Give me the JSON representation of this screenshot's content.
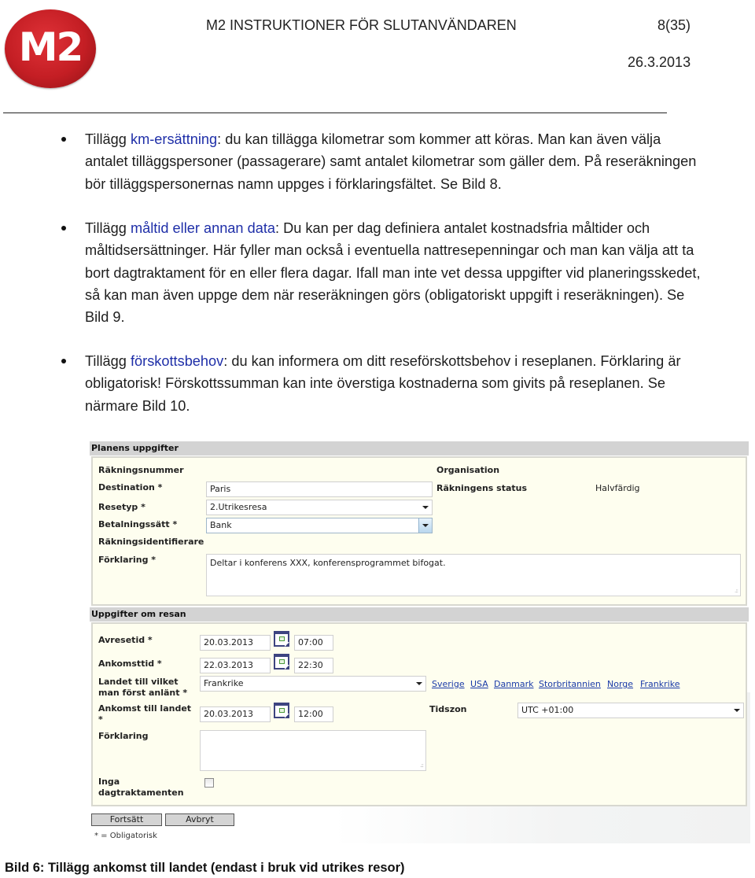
{
  "header": {
    "logo_text": "M2",
    "title": "M2 INSTRUKTIONER FÖR SLUTANVÄNDAREN",
    "page": "8(35)",
    "date": "26.3.2013"
  },
  "bullets": [
    {
      "prefix": "Tillägg ",
      "keyword": "km-ersättning",
      "text": ": du kan tillägga kilometrar som kommer att köras. Man kan även välja antalet tilläggspersoner (passagerare) samt antalet kilometrar som gäller dem. På reseräkningen bör tilläggspersonernas namn uppges i förklaringsfältet. Se Bild 8."
    },
    {
      "prefix": "Tillägg ",
      "keyword": "måltid eller annan data",
      "text": ": Du kan per dag definiera antalet kostnadsfria måltider och måltidsersättninger. Här fyller man också i eventuella nattresepenningar och man kan välja att ta bort dagtraktament för en eller flera dagar. Ifall man inte vet dessa uppgifter vid planeringsskedet, så kan man även uppge dem när reseräkningen görs (obligatoriskt uppgift i reseräkningen). Se Bild 9."
    },
    {
      "prefix": "Tillägg ",
      "keyword": "förskottsbehov",
      "text": ": du kan informera om ditt reseförskottsbehov i reseplanen. Förklaring är obligatorisk! Förskottssumman kan inte överstiga kostnaderna som givits på reseplanen. Se närmare Bild 10."
    }
  ],
  "form": {
    "plan_section": {
      "title": "Planens uppgifter",
      "invoice_number_label": "Räkningsnummer",
      "organisation_label": "Organisation",
      "destination_label": "Destination *",
      "destination_value": "Paris",
      "status_label": "Räkningens status",
      "status_value": "Halvfärdig",
      "travel_type_label": "Resetyp *",
      "travel_type_value": "2.Utrikesresa",
      "payment_label": "Betalningssätt *",
      "payment_value": "Bank",
      "identifier_label": "Räkningsidentifierare",
      "explanation_label": "Förklaring *",
      "explanation_value": "Deltar i konferens XXX, konferensprogrammet bifogat."
    },
    "trip_section": {
      "title": "Uppgifter om resan",
      "departure_label": "Avresetid *",
      "departure_date": "20.03.2013",
      "departure_time": "07:00",
      "arrival_label": "Ankomsttid *",
      "arrival_date": "22.03.2013",
      "arrival_time": "22:30",
      "first_country_label_1": "Landet till vilket",
      "first_country_label_2": "man först anlänt *",
      "first_country_value": "Frankrike",
      "country_links": [
        "Sverige",
        "USA",
        "Danmark",
        "Storbritannien",
        "Norge",
        "Frankrike"
      ],
      "country_arrival_label_1": "Ankomst till landet",
      "country_arrival_label_2": "*",
      "country_arrival_date": "20.03.2013",
      "country_arrival_time": "12:00",
      "timezone_label": "Tidszon",
      "timezone_value": "UTC +01:00",
      "explanation_label": "Förklaring",
      "explanation_value": "",
      "no_allowance_label_1": "Inga",
      "no_allowance_label_2": "dagtraktamenten",
      "no_allowance_checked": false
    },
    "continue_button": "Fortsätt",
    "cancel_button": "Avbryt",
    "required_note": "* = Obligatorisk"
  },
  "caption": "Bild 6: Tillägg ankomst till landet (endast i bruk vid utrikes resor)"
}
